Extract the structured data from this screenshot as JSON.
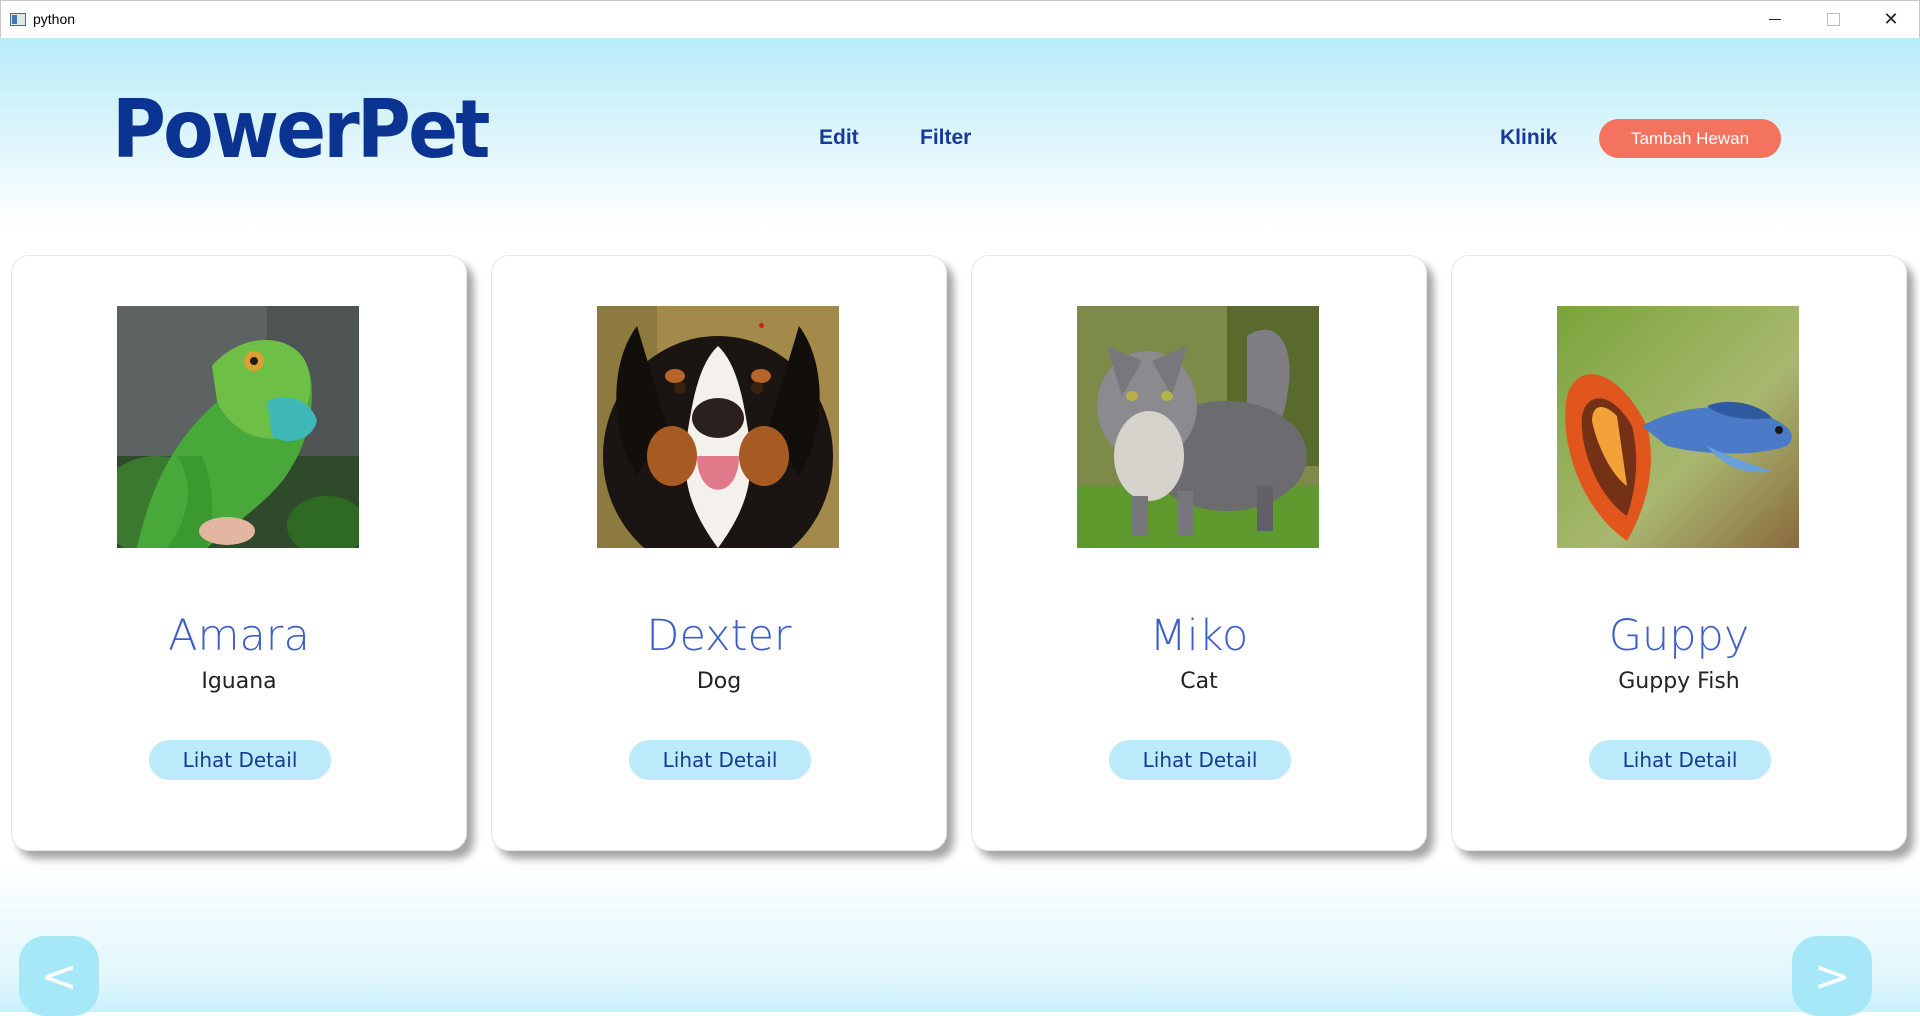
{
  "window": {
    "title": "python",
    "controls": {
      "minimize": "minimize-icon",
      "maximize": "maximize-icon",
      "close": "close-icon"
    }
  },
  "header": {
    "logo": "PowerPet",
    "nav": {
      "edit": "Edit",
      "filter": "Filter",
      "klinik": "Klinik"
    },
    "add_button": "Tambah Hewan"
  },
  "pets": [
    {
      "name": "Amara",
      "species": "Iguana",
      "button": "Lihat Detail",
      "image": "iguana-photo"
    },
    {
      "name": "Dexter",
      "species": "Dog",
      "button": "Lihat Detail",
      "image": "dog-photo"
    },
    {
      "name": "Miko",
      "species": "Cat",
      "button": "Lihat Detail",
      "image": "cat-photo"
    },
    {
      "name": "Guppy",
      "species": "Guppy Fish",
      "button": "Lihat Detail",
      "image": "fish-photo"
    }
  ],
  "pager": {
    "prev": "<",
    "next": ">"
  },
  "colors": {
    "brand": "#0b3391",
    "accent": "#f3735f",
    "pet_name": "#3d5ec9",
    "detail_button": "#bdeafb",
    "pager_button": "#a6e7f8"
  }
}
